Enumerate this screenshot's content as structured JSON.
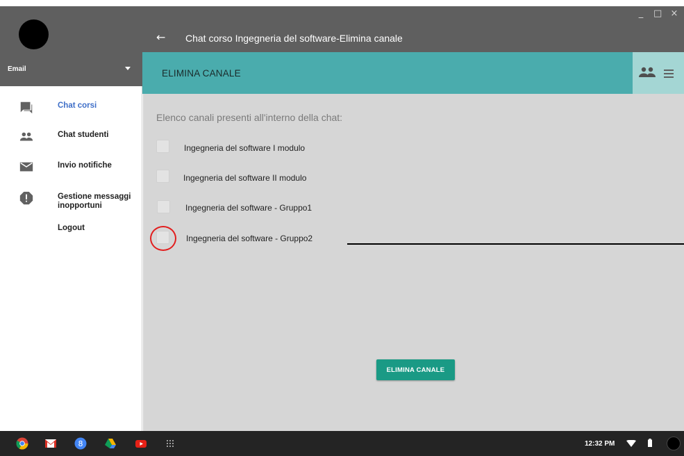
{
  "window": {
    "controls": {
      "minimize": "_",
      "maximize": "□",
      "close": "×"
    }
  },
  "sidebar": {
    "account_label": "Email",
    "items": [
      {
        "label": "Chat corsi",
        "icon": "chat-icon",
        "active": true
      },
      {
        "label": "Chat studenti",
        "icon": "people-icon",
        "active": false
      },
      {
        "label": "Invio notifiche",
        "icon": "mail-icon",
        "active": false
      },
      {
        "label": "Gestione messaggi inopportuni",
        "icon": "alert-icon",
        "active": false
      },
      {
        "label": "Logout",
        "icon": "",
        "active": false
      }
    ]
  },
  "app_bar": {
    "back_icon": "←",
    "title": "Chat corso Ingegneria del software-Elimina canale"
  },
  "toolbar": {
    "title": "ELIMINA CANALE",
    "actions": [
      "people-icon",
      "menu-icon"
    ]
  },
  "content": {
    "heading": "Elenco canali presenti all'interno della chat:",
    "channels": [
      {
        "label": "Ingegneria del software I modulo",
        "checked": false
      },
      {
        "label": "Ingegneria del software II modulo",
        "checked": false
      },
      {
        "label": "Ingegneria del software - Gruppo1",
        "checked": false
      },
      {
        "label": "Ingegneria del software - Gruppo2",
        "checked": false
      }
    ],
    "button_label": "ELIMINA CANALE"
  },
  "shelf": {
    "apps": [
      "chrome-icon",
      "gmail-icon",
      "google-plus-icon",
      "drive-icon",
      "youtube-icon",
      "app-launcher-icon"
    ],
    "clock": "12:32 PM",
    "status": [
      "wifi-icon",
      "battery-icon",
      "user-avatar"
    ]
  },
  "colors": {
    "accent_teal": "#4aacad",
    "button_green": "#1a9a85",
    "active_nav": "#3f6fc8",
    "annotation_red": "#e21d1d"
  }
}
